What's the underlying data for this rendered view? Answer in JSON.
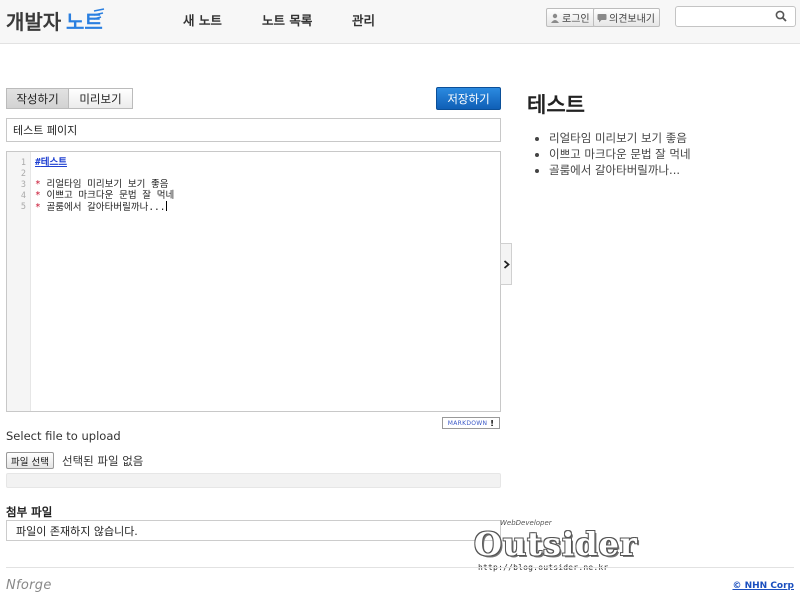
{
  "header": {
    "logo_text": "개발자노트",
    "nav": [
      "새 노트",
      "노트 목록",
      "관리"
    ],
    "login_label": "로그인",
    "feedback_label": "의견보내기",
    "search": {
      "value": "",
      "placeholder": ""
    }
  },
  "editor": {
    "tabs": [
      {
        "label": "작성하기",
        "active": true
      },
      {
        "label": "미리보기",
        "active": false
      }
    ],
    "save_label": "저장하기",
    "title_value": "테스트 페이지",
    "line_numbers": [
      "1",
      "2",
      "3",
      "4",
      "5"
    ],
    "lines": {
      "l1_heading": "테스트",
      "l3": "리얼타임 미리보기 보기 좋음",
      "l4": "이쁘고 마크다운 문법 잘 먹네",
      "l5": "골룸에서 갈아타버릴까나..."
    },
    "markdown_badge": "MARKDOWN"
  },
  "upload": {
    "select_label": "Select file to upload",
    "file_button": "파일 선택",
    "no_file": "선택된 파일 없음"
  },
  "attachments": {
    "title": "첨부 파일",
    "empty": "파일이 존재하지 않습니다."
  },
  "preview": {
    "title": "테스트",
    "items": [
      "리얼타임 미리보기 보기 좋음",
      "이쁘고 마크다운 문법 잘 먹네",
      "골룸에서 갈아타버릴까나..."
    ]
  },
  "footer": {
    "brand": "Nforge",
    "copyright": "© NHN Corp"
  },
  "watermark": {
    "top": "WebDeveloper",
    "main": "Outsider",
    "url": "http://blog.outsider.ne.kr"
  },
  "colors": {
    "accent": "#0f5fb6",
    "heading": "#1e3fd1",
    "bullet": "#c8102e"
  }
}
